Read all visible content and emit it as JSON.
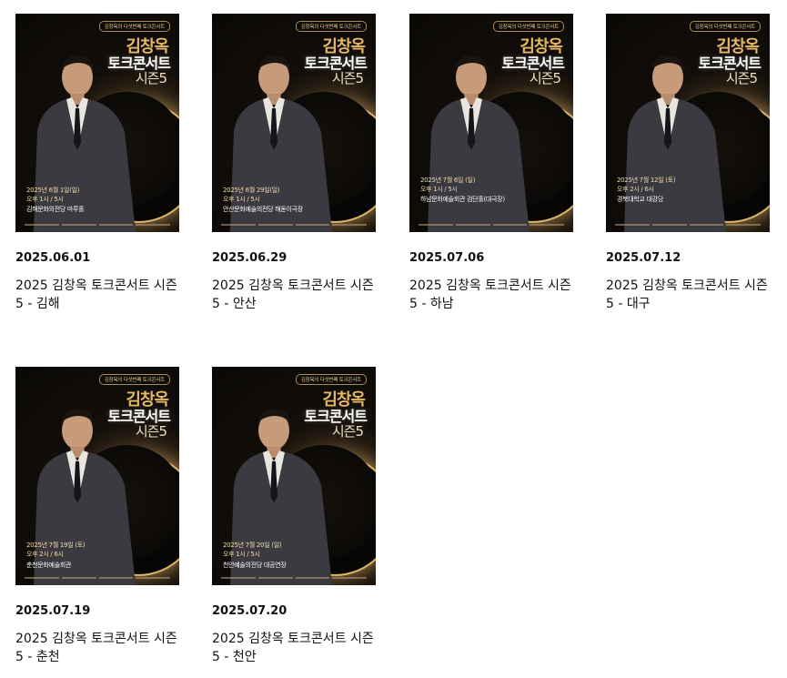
{
  "events": [
    {
      "date": "2025.06.01",
      "title": "2025 김창옥 토크콘서트 시즌5 - 김해",
      "poster": {
        "tag": "김창옥의 다섯번째 토크콘서트",
        "name": "김창옥",
        "main": "토크콘서트",
        "season": "시즌5",
        "show_date": "2025년 6월 1일(일)",
        "show_time": "오후 1시 / 5시",
        "venue": "김해문화의전당 마루홀"
      }
    },
    {
      "date": "2025.06.29",
      "title": "2025 김창옥 토크콘서트 시즌 5 - 안산",
      "poster": {
        "tag": "김창옥의 다섯번째 토크콘서트",
        "name": "김창옥",
        "main": "토크콘서트",
        "season": "시즌5",
        "show_date": "2025년 6월 29일(일)",
        "show_time": "오후 1시 / 5시",
        "venue": "안산문화예술의전당 해돋이극장"
      }
    },
    {
      "date": "2025.07.06",
      "title": "2025 김창옥 토크콘서트 시즌5 - 하남",
      "poster": {
        "tag": "김창옥의 다섯번째 토크콘서트",
        "name": "김창옥",
        "main": "토크콘서트",
        "season": "시즌5",
        "show_date": "2025년 7월 6일 (일)",
        "show_time": "오후 1시 / 5시",
        "venue": "하남문화예술회관 검단홀(대극장)"
      }
    },
    {
      "date": "2025.07.12",
      "title": "2025 김창옥 토크콘서트 시즌5 - 대구",
      "poster": {
        "tag": "김창옥의 다섯번째 토크콘서트",
        "name": "김창옥",
        "main": "토크콘서트",
        "season": "시즌5",
        "show_date": "2025년 7월 12일 (토)",
        "show_time": "오후 2시 / 6시",
        "venue": "경북대학교 대강당"
      }
    },
    {
      "date": "2025.07.19",
      "title": "2025 김창옥 토크콘서트 시즌5 - 춘천",
      "poster": {
        "tag": "김창옥의 다섯번째 토크콘서트",
        "name": "김창옥",
        "main": "토크콘서트",
        "season": "시즌5",
        "show_date": "2025년 7월 19일 (토)",
        "show_time": "오후 2시 / 6시",
        "venue": "춘천문화예술회관"
      }
    },
    {
      "date": "2025.07.20",
      "title": "2025 김창옥 토크콘서트 시즌5 - 천안",
      "poster": {
        "tag": "김창옥의 다섯번째 토크콘서트",
        "name": "김창옥",
        "main": "토크콘서트",
        "season": "시즌5",
        "show_date": "2025년 7월 20일 (일)",
        "show_time": "오후 1시 / 5시",
        "venue": "천안예술의전당 대공연장"
      }
    }
  ],
  "colors": {
    "accent_gold": "#e6b866",
    "poster_bg": "#0a0806"
  }
}
